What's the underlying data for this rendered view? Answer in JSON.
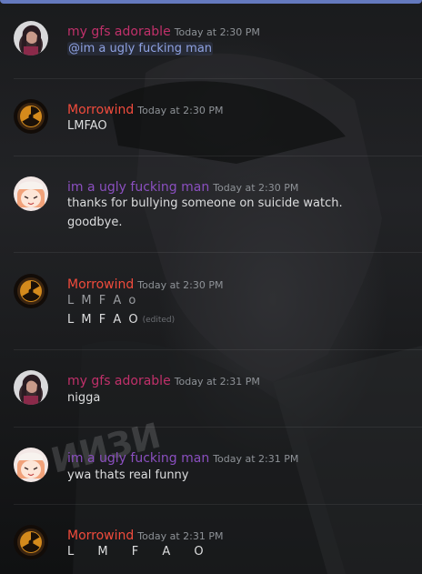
{
  "colors": {
    "gfs": "#c0306a",
    "morrowind": "#f04b3c",
    "ugly": "#8a4fbf",
    "mention": "#8ea1e1"
  },
  "messages": [
    {
      "author": "my gfs adorable",
      "timestamp": "Today at 2:30 PM",
      "lines": [
        "@im a ugly fucking man"
      ],
      "avatar": "gfs-avatar-icon"
    },
    {
      "author": "Morrowind",
      "timestamp": "Today at 2:30 PM",
      "lines": [
        "LMFAO"
      ],
      "avatar": "radiation-avatar-icon"
    },
    {
      "author": "im a ugly fucking man",
      "timestamp": "Today at 2:30 PM",
      "lines": [
        "thanks for bullying someone on suicide watch.",
        "goodbye."
      ],
      "avatar": "anime-avatar-icon"
    },
    {
      "author": "Morrowind",
      "timestamp": "Today at 2:30 PM",
      "lines": [
        "L M F A o",
        "L M F A O"
      ],
      "edited": "(edited)",
      "avatar": "radiation-avatar-icon"
    },
    {
      "author": "my gfs adorable",
      "timestamp": "Today at 2:31 PM",
      "lines": [
        "nigga"
      ],
      "avatar": "gfs-avatar-icon"
    },
    {
      "author": "im a ugly fucking man",
      "timestamp": "Today at 2:31 PM",
      "lines": [
        "ywa thats real funny"
      ],
      "avatar": "anime-avatar-icon"
    },
    {
      "author": "Morrowind",
      "timestamp": "Today at 2:31 PM",
      "lines": [
        "L M F A O"
      ],
      "avatar": "radiation-avatar-icon"
    }
  ]
}
